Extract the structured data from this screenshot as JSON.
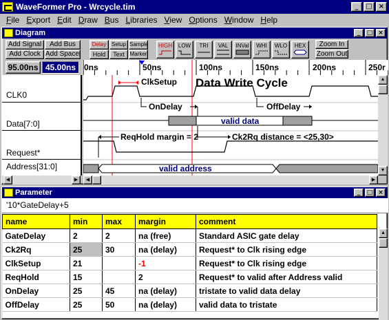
{
  "app": {
    "title": "WaveFormer Pro - Wrcycle.tim"
  },
  "menu": [
    "File",
    "Export",
    "Edit",
    "Draw",
    "Bus",
    "Libraries",
    "View",
    "Options",
    "Window",
    "Help"
  ],
  "diagram": {
    "title": "Diagram",
    "toolbar": {
      "add_signal": "Add Signal",
      "add_bus": "Add Bus",
      "add_clock": "Add Clock",
      "add_spacer": "Add Spacer",
      "delay": "Delay",
      "setup": "Setup",
      "sample": "Sample",
      "hold": "Hold",
      "text": "Text",
      "marker": "Marker",
      "high": "HIGH",
      "low": "LOW",
      "tri": "TRI",
      "val": "VAL",
      "inval": "INVal",
      "whi": "WHI",
      "wlo": "WLO",
      "hex": "HEX",
      "zoom_in": "Zoom In",
      "zoom_out": "Zoom Out"
    },
    "cursor_time": "95.00ns",
    "delta_time": "45.00ns",
    "time_ticks": [
      "0ns",
      "50ns",
      "100ns",
      "150ns",
      "200ns",
      "250r"
    ],
    "signals": [
      "CLK0",
      "Data[7:0]",
      "Request*",
      "Address[31:0]"
    ],
    "diagram_title": "Data Write Cycle",
    "labels": {
      "clk_setup": "ClkSetup",
      "on_delay": "OnDelay",
      "off_delay": "OffDelay",
      "valid_data": "valid data",
      "req_hold": "ReqHold margin = 2",
      "ck2rq": "Ck2Rq distance = <25,30>",
      "valid_address": "valid address"
    },
    "colors": {
      "accent_blue": "#000080",
      "bus_grey": "#a0a0a0",
      "red_marker": "#ff0000"
    }
  },
  "parameter": {
    "title": "Parameter",
    "formula": "'10*GateDelay+5",
    "columns": [
      "name",
      "min",
      "max",
      "margin",
      "comment"
    ],
    "rows": [
      {
        "name": "GateDelay",
        "min": "2",
        "max": "2",
        "margin": "na (free)",
        "comment": "Standard ASIC gate delay"
      },
      {
        "name": "Ck2Rq",
        "min": "25",
        "max": "30",
        "margin": "na (delay)",
        "comment": "Request* to Clk rising edge"
      },
      {
        "name": "ClkSetup",
        "min": "21",
        "max": "",
        "margin": "-1",
        "comment": "Request* to Clk rising edge"
      },
      {
        "name": "ReqHold",
        "min": "15",
        "max": "",
        "margin": "2",
        "comment": "Request* to valid after Address valid"
      },
      {
        "name": "OnDelay",
        "min": "25",
        "max": "45",
        "margin": "na (delay)",
        "comment": "tristate to valid data delay"
      },
      {
        "name": "OffDelay",
        "min": "25",
        "max": "50",
        "margin": "na (delay)",
        "comment": "valid data to tristate"
      }
    ]
  }
}
